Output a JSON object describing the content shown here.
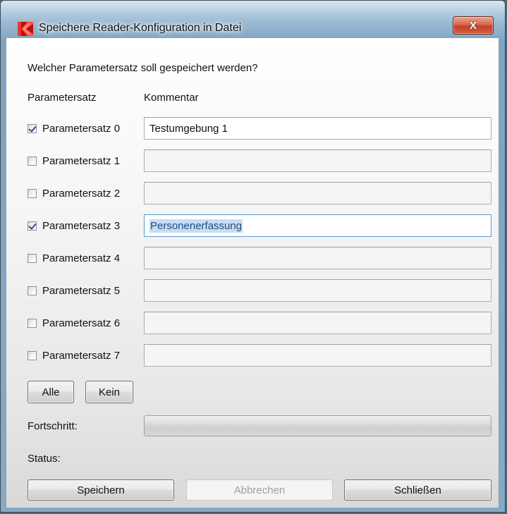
{
  "window": {
    "title": "Speichere Reader-Konfiguration in Datei",
    "close_glyph": "X",
    "logo_icon": "app-logo-red-icon"
  },
  "question": "Welcher Parametersatz soll gespeichert werden?",
  "headers": {
    "parameter": "Parametersatz",
    "comment": "Kommentar"
  },
  "rows": [
    {
      "label": "Parametersatz 0",
      "checked": true,
      "comment": "Testumgebung 1"
    },
    {
      "label": "Parametersatz 1",
      "checked": false,
      "comment": ""
    },
    {
      "label": "Parametersatz 2",
      "checked": false,
      "comment": ""
    },
    {
      "label": "Parametersatz 3",
      "checked": true,
      "comment": "Personenerfassung",
      "focused": true
    },
    {
      "label": "Parametersatz 4",
      "checked": false,
      "comment": ""
    },
    {
      "label": "Parametersatz 5",
      "checked": false,
      "comment": ""
    },
    {
      "label": "Parametersatz 6",
      "checked": false,
      "comment": ""
    },
    {
      "label": "Parametersatz 7",
      "checked": false,
      "comment": ""
    }
  ],
  "select_buttons": {
    "all": "Alle",
    "none": "Kein"
  },
  "progress": {
    "label": "Fortschritt:",
    "value": 0
  },
  "status": {
    "label": "Status:",
    "text": ""
  },
  "actions": {
    "save": "Speichern",
    "cancel": "Abbrechen",
    "close": "Schließen"
  },
  "colors": {
    "accent_blue": "#5a9ad6",
    "selection": "#c9ddf2",
    "close_red": "#c2402a",
    "logo_red": "#e02020"
  }
}
